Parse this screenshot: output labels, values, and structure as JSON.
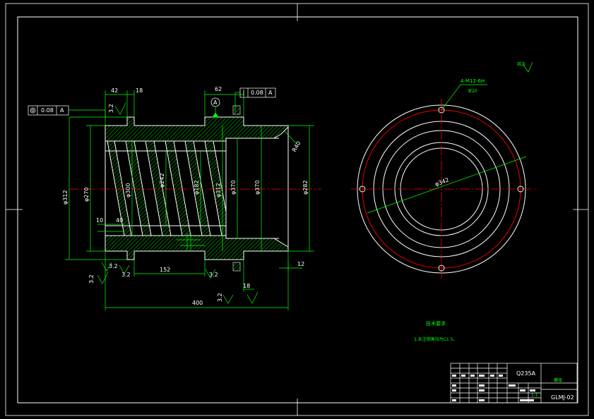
{
  "colors": {
    "background": "#000000",
    "outline": "#ffffff",
    "dimension": "#00ff00",
    "centerline": "#ff0000",
    "hatch": "#00ff00"
  },
  "title_block": {
    "material": "Q235A",
    "drawing_number": "GLMJ-02",
    "part_name": "螺母",
    "scale_label": "1:1"
  },
  "annotations": {
    "roughness_all": "其余",
    "technical_requirements_title": "技术要求",
    "technical_requirement_1": "1.未注倒角均为C1.5。"
  },
  "datum": {
    "label": "A"
  },
  "front_view": {
    "dim_42_top": "42",
    "dim_18_top": "18",
    "dim_62_top": "62",
    "tolerance_left": "0.08",
    "tolerance_left_datum": "A",
    "tolerance_right": "0.08",
    "tolerance_right_datum": "A",
    "dim_r40": "R40",
    "dia_312_left": "φ312",
    "dia_270": "φ270",
    "dia_300": "φ300",
    "dia_242": "φ242",
    "dia_182": "φ182",
    "dia_312_mid": "φ312",
    "dia_370": "φ370",
    "dia_370_b": "φ370",
    "dia_282": "φ282",
    "dim_10": "10",
    "dim_40": "40",
    "rough_32_a": "3.2",
    "rough_32_b": "3.2",
    "rough_32_c": "3.2",
    "rough_32_d": "3.2",
    "rough_32_e": "3.2",
    "rough_32_f": "3.2",
    "dim_152": "152",
    "dim_12": "12",
    "dim_18_bottom": "18",
    "dim_400": "400"
  },
  "side_view": {
    "thread_callout": "4-M12-6H",
    "thread_depth": "深20",
    "bolt_circle": "φ342"
  }
}
